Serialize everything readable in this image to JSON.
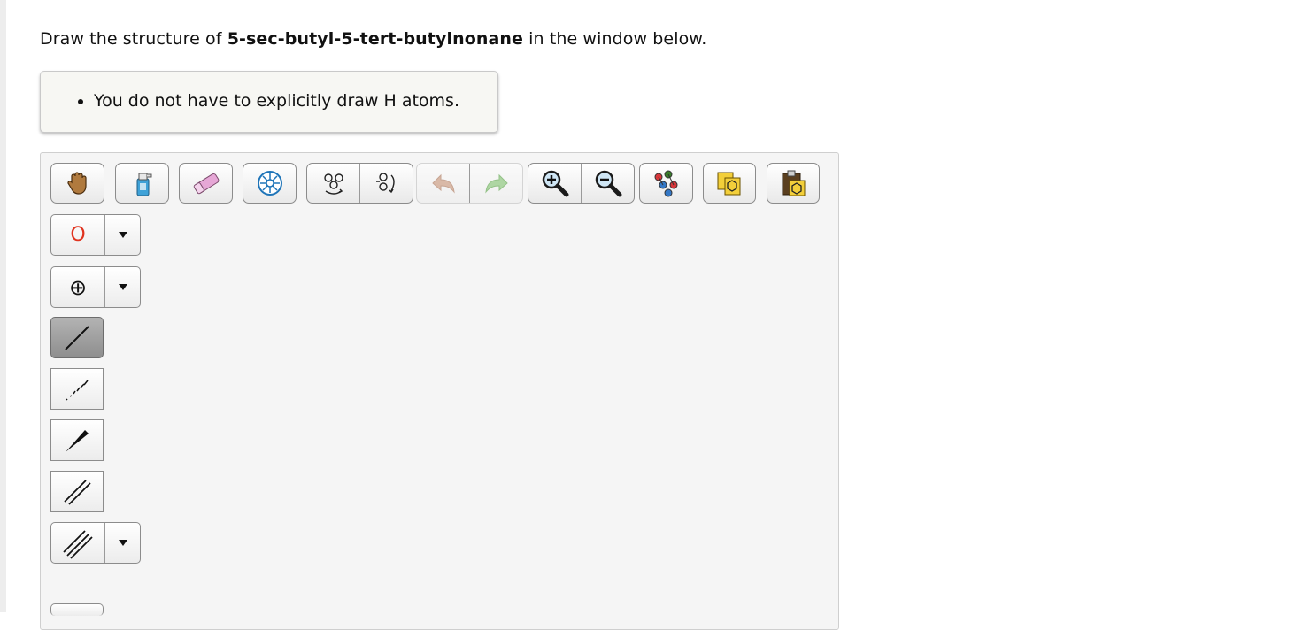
{
  "question": {
    "prefix": "Draw the structure of ",
    "compound": "5-sec-butyl-5-tert-butylnonane",
    "suffix": " in the window below."
  },
  "hints": [
    "You do not have to explicitly draw H atoms."
  ],
  "toolbar": {
    "icons": [
      "hand-icon",
      "spray-bottle-icon",
      "eraser-icon",
      "ring-settings-icon",
      "flip-molecule-icon",
      "rotate-molecule-icon",
      "undo-icon",
      "redo-icon",
      "zoom-in-icon",
      "zoom-out-icon",
      "clean-structure-icon",
      "copy-icon",
      "paste-icon"
    ],
    "undo_enabled": false,
    "redo_enabled": false
  },
  "side_tools": {
    "atom_label": "O",
    "atom_color": "#e0331f",
    "charge_symbol": "⊕",
    "active_tool": "single-bond"
  }
}
